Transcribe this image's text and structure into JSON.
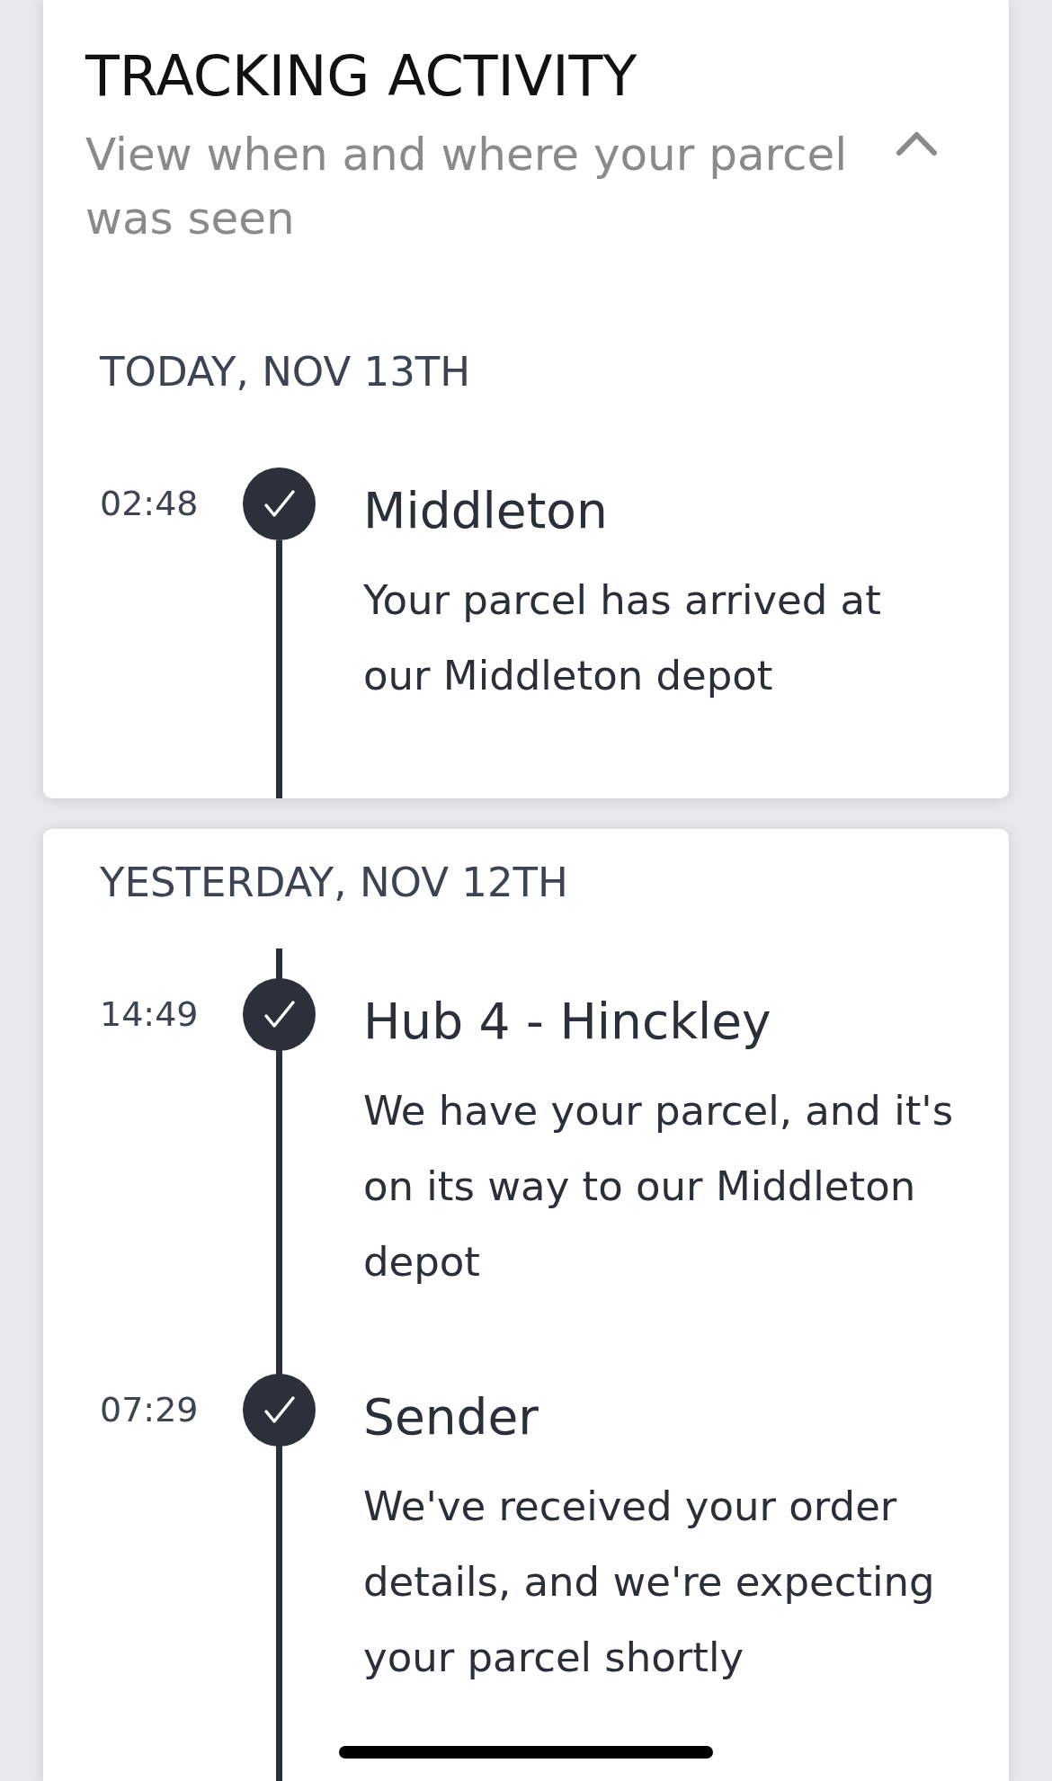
{
  "header": {
    "title": "TRACKING ACTIVITY",
    "subtitle": "View when and where your parcel was seen",
    "expanded": true
  },
  "days": [
    {
      "heading": "TODAY, NOV 13TH",
      "events": [
        {
          "time": "02:48",
          "place": "Middleton",
          "description": "Your parcel has arrived at our Middleton depot",
          "done": true
        }
      ]
    },
    {
      "heading": "YESTERDAY, NOV 12TH",
      "events": [
        {
          "time": "14:49",
          "place": "Hub 4 - Hinckley",
          "description": "We have your parcel, and it's on its way to our Middleton depot",
          "done": true
        },
        {
          "time": "07:29",
          "place": "Sender",
          "description": "We've received your order details, and we're expecting your parcel shortly",
          "done": true
        }
      ]
    }
  ]
}
